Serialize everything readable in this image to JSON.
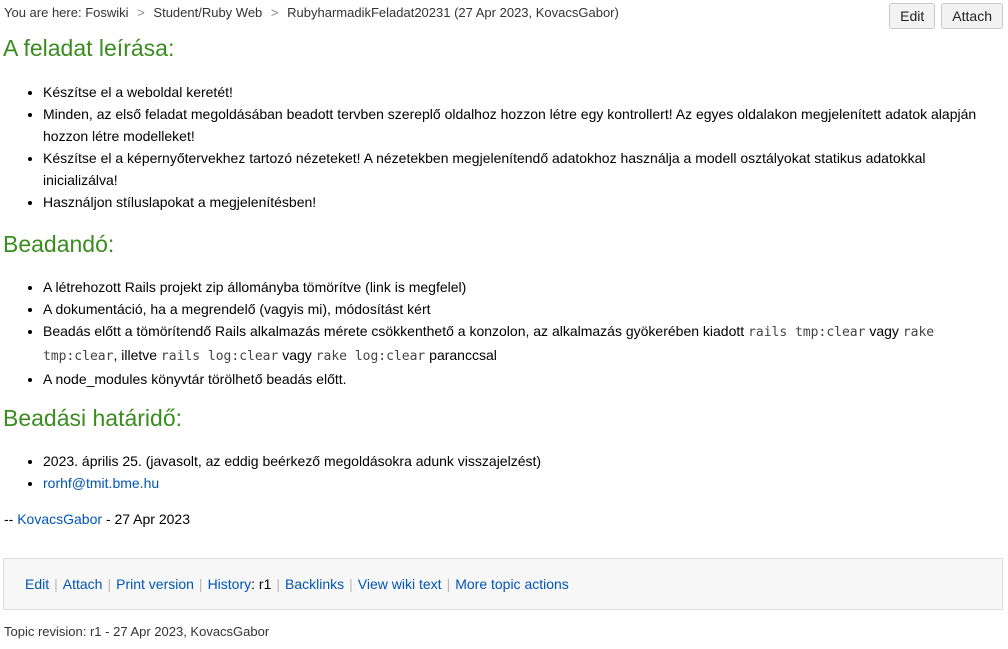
{
  "breadcrumb": {
    "prefix": "You are here:",
    "crumbs": [
      "Foswiki",
      "Student/Ruby Web"
    ],
    "current": "RubyharmadikFeladat20231 (27 Apr 2023, KovacsGabor)",
    "separator": ">"
  },
  "actions": {
    "edit": "Edit",
    "attach": "Attach"
  },
  "sections": {
    "task": {
      "heading": "A feladat leírása:",
      "items": [
        "Készítse el a weboldal keretét!",
        "Minden, az első feladat megoldásában beadott tervben szereplő oldalhoz hozzon létre egy kontrollert! Az egyes oldalakon megjelenített adatok alapján hozzon létre modelleket!",
        "Készítse el a képernyőtervekhez tartozó nézeteket! A nézetekben megjelenítendő adatokhoz használja a modell osztályokat statikus adatokkal inicializálva!",
        "Használjon stíluslapokat a megjelenítésben!"
      ]
    },
    "submit": {
      "heading": "Beadandó:",
      "item1": "A létrehozott Rails projekt zip állományba tömörítve (link is megfelel)",
      "item2": "A dokumentáció, ha a megrendelő (vagyis mi), módosítást kért",
      "item3": {
        "t1": "Beadás előtt a tömörítendő Rails alkalmazás mérete csökkenthető a konzolon, az alkalmazás gyökerében kiadott ",
        "c1": "rails tmp:clear",
        "t2": " vagy ",
        "c2": "rake tmp:clear",
        "t3": ", illetve ",
        "c3": "rails log:clear",
        "t4": " vagy ",
        "c4": "rake log:clear",
        "t5": " paranccsal"
      },
      "item4": "A node_modules könyvtár törölhető beadás előtt."
    },
    "deadline": {
      "heading": "Beadási határidő:",
      "item1": "2023. április 25. (javasolt, az eddig beérkező megoldásokra adunk visszajelzést)",
      "email": "rorhf@tmit.bme.hu"
    }
  },
  "signature": {
    "prefix": "--",
    "author": "KovacsGabor",
    "date": "- 27 Apr 2023"
  },
  "footer": {
    "links": {
      "edit": "Edit",
      "attach": "Attach",
      "print": "Print version",
      "history": "History",
      "history_rev": ": r1",
      "backlinks": "Backlinks",
      "view_text": "View wiki text",
      "more": "More topic actions"
    },
    "separator": "|"
  },
  "revision": "Topic revision: r1 - 27 Apr 2023, KovacsGabor",
  "colors": {
    "heading": "#3a8c1f",
    "link": "#0055b5"
  }
}
